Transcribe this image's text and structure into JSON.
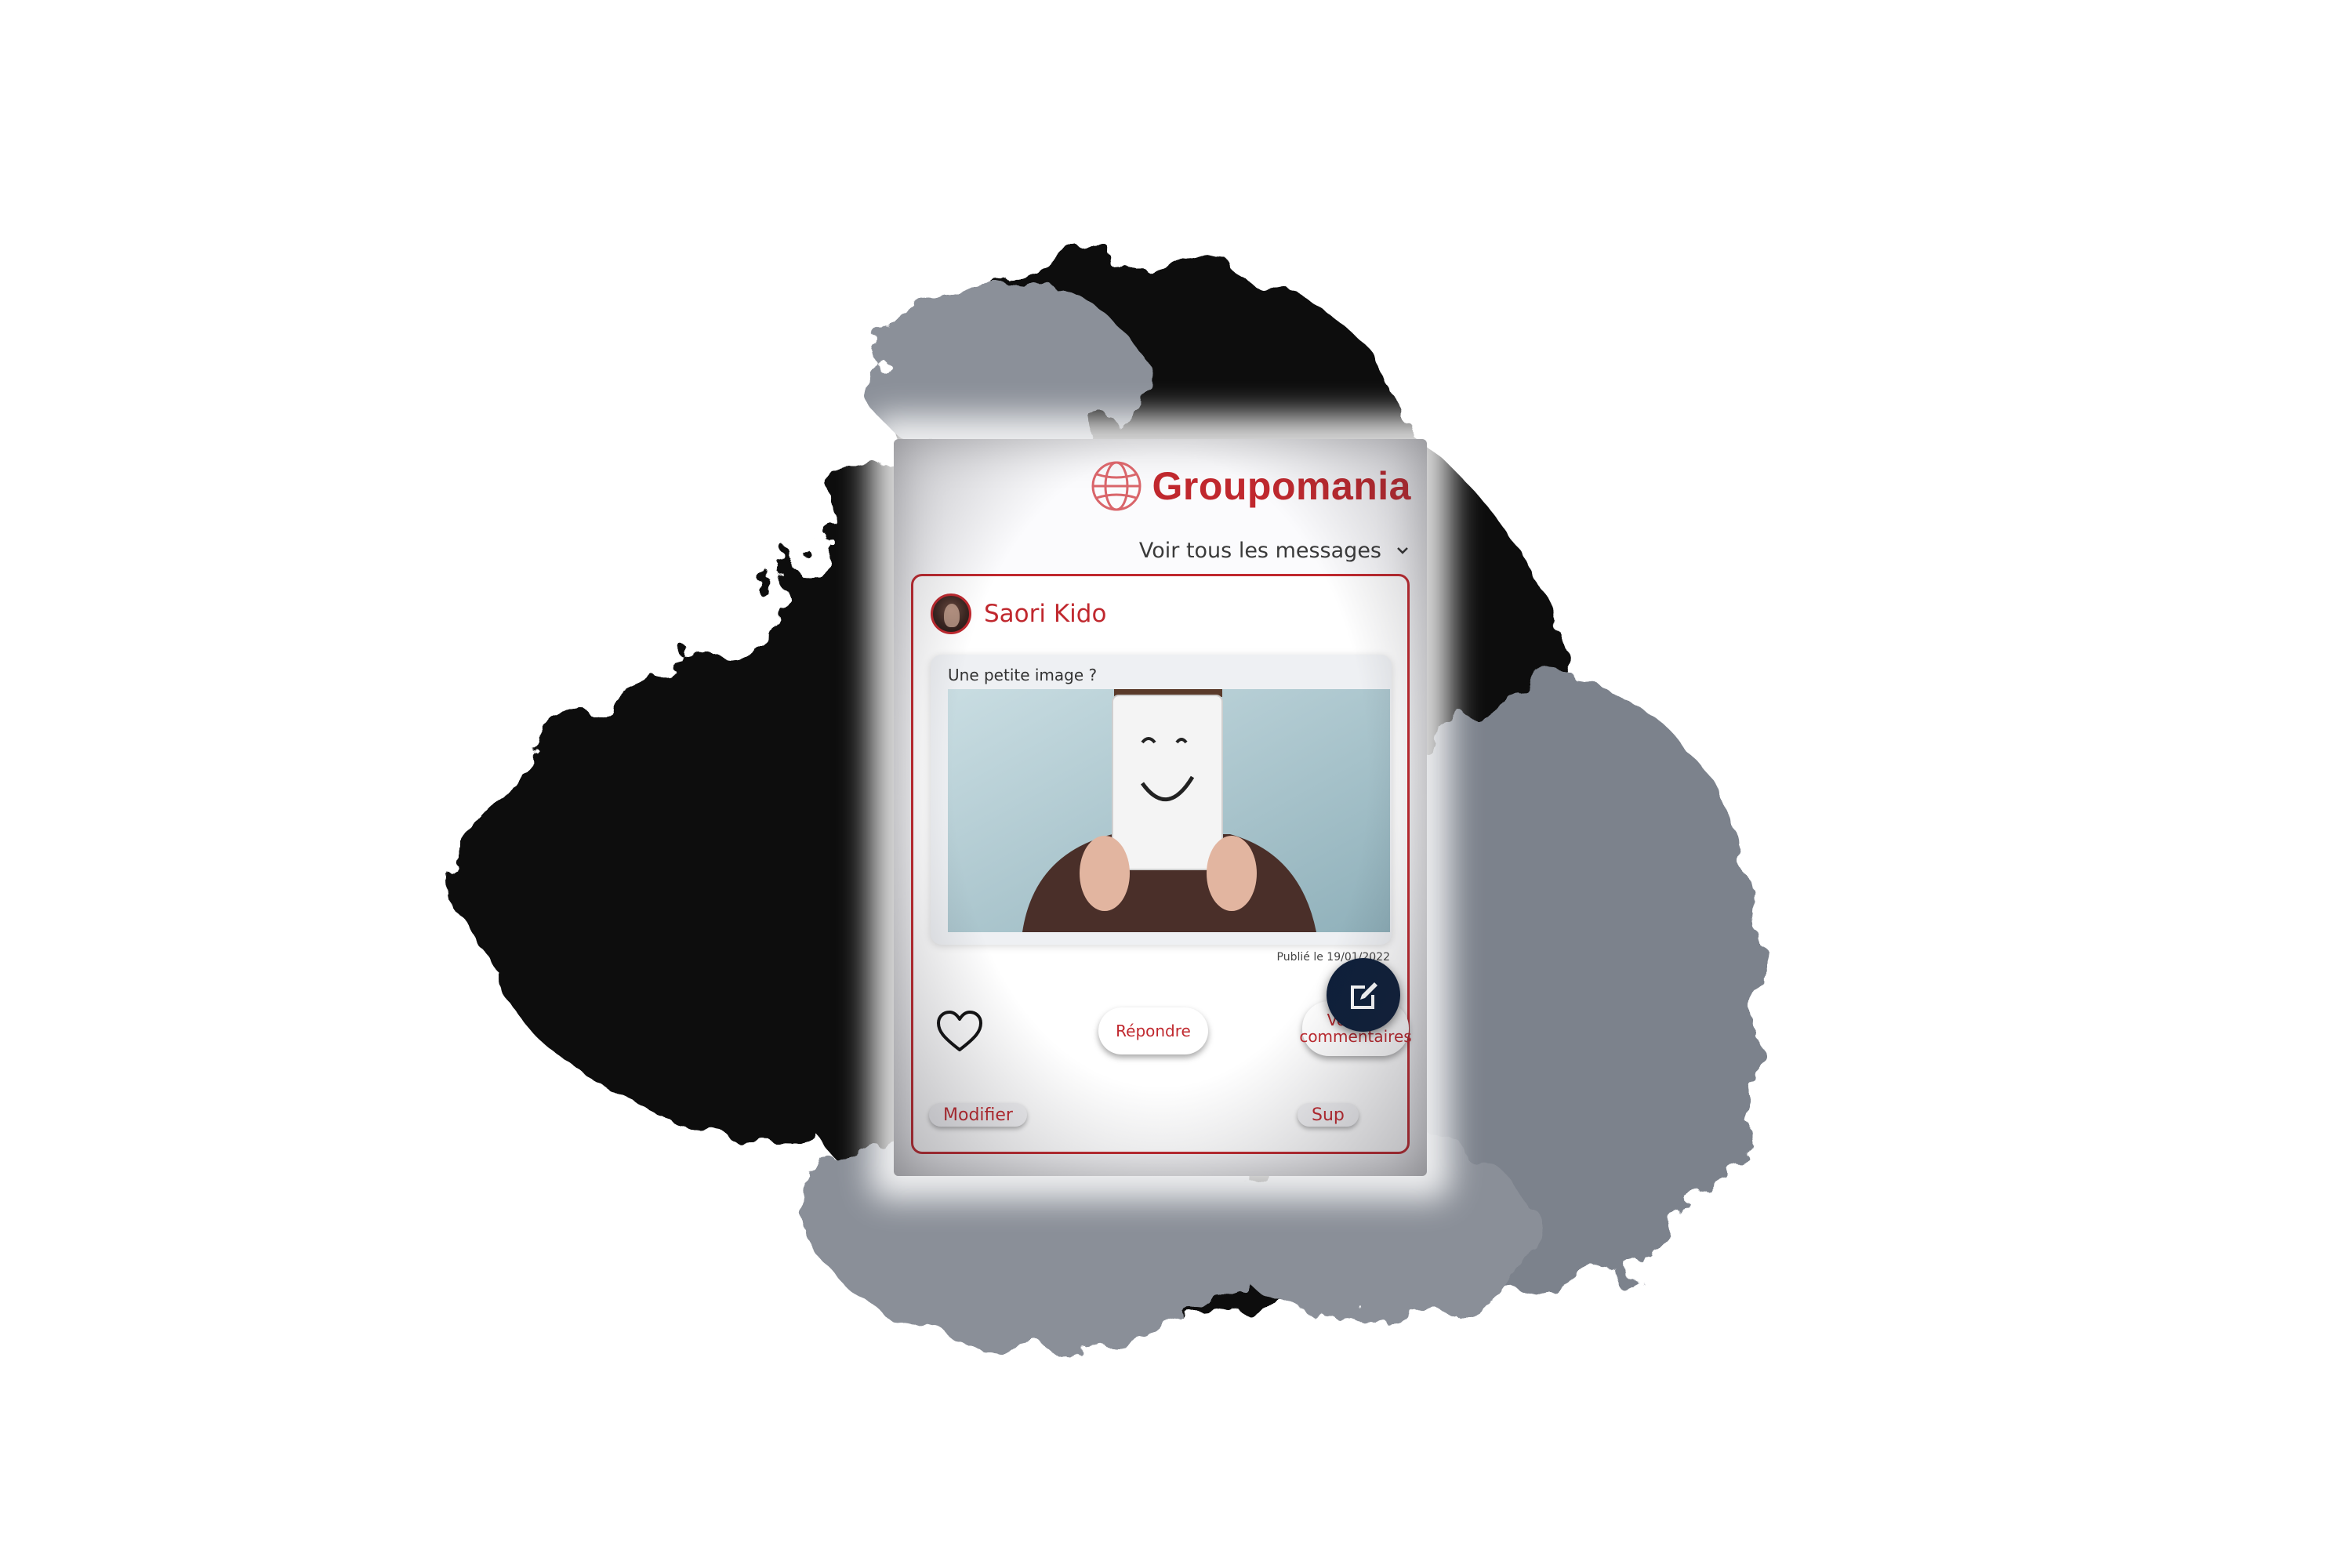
{
  "header": {
    "brand_name": "Groupomania",
    "brand_icon": "globe-icon",
    "brand_color": "#c0282e"
  },
  "filter": {
    "selected": "Voir tous les messages",
    "icon": "chevron-down-icon"
  },
  "post": {
    "author": "Saori Kido",
    "caption": "Une petite image ?",
    "image": "photo of a man holding a smiley face card",
    "date": "Publié le 19/01/2022",
    "actions": {
      "like_icon": "heart-icon",
      "reply": "Répondre",
      "view_comments": "Voir les commentaires",
      "edit": "Modifier",
      "delete": "Sup"
    }
  },
  "fab": {
    "icon": "edit-icon",
    "color": "#0e1f3a"
  }
}
